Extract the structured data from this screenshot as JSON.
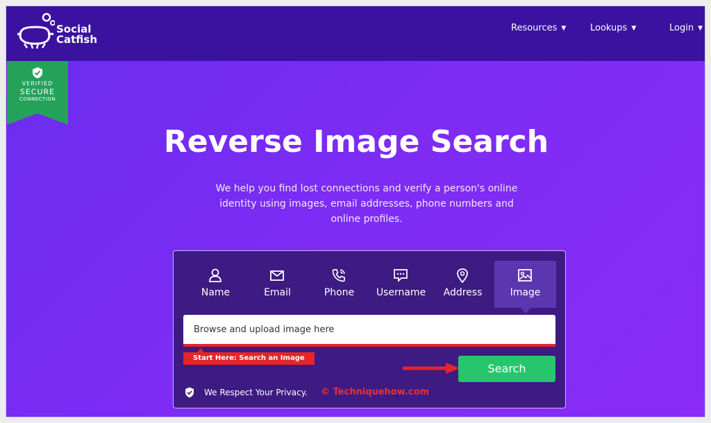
{
  "brand": {
    "line1": "Social",
    "line2": "Catfish"
  },
  "nav": {
    "items": [
      {
        "label": "Resources"
      },
      {
        "label": "Lookups"
      },
      {
        "label": "Login"
      }
    ]
  },
  "badge": {
    "line1": "VERIFIED",
    "line2": "SECURE",
    "line3": "CONNECTION"
  },
  "hero": {
    "title": "Reverse Image Search",
    "description": "We help you find lost connections and verify a person's online identity using images, email addresses, phone numbers and online profiles."
  },
  "search": {
    "tabs": [
      {
        "label": "Name",
        "icon": "person-icon"
      },
      {
        "label": "Email",
        "icon": "envelope-icon"
      },
      {
        "label": "Phone",
        "icon": "phone-icon"
      },
      {
        "label": "Username",
        "icon": "chat-icon"
      },
      {
        "label": "Address",
        "icon": "map-pin-icon"
      },
      {
        "label": "Image",
        "icon": "image-icon"
      }
    ],
    "active_tab": "Image",
    "upload_placeholder": "Browse and upload image here",
    "hint": "Start Here: Search an Image",
    "button_label": "Search",
    "privacy_text": "We Respect Your Privacy."
  },
  "watermark": "© Techniquehow.com",
  "colors": {
    "nav_bg": "#3b12a0",
    "hero_bg": "#7d2cf4",
    "card_bg": "#3d1b82",
    "badge_bg": "#24a25a",
    "accent_red": "#e5252a",
    "search_green": "#27c66d"
  }
}
